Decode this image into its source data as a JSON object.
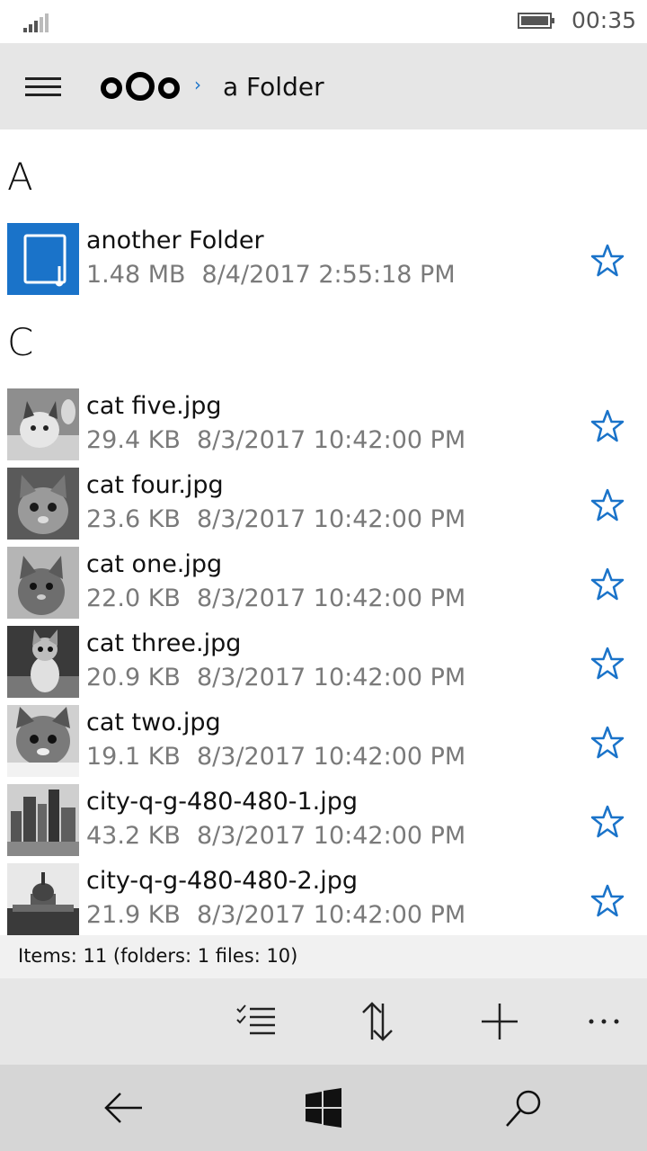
{
  "status": {
    "time": "00:35"
  },
  "header": {
    "breadcrumb_separator": "›",
    "folder_title": "a Folder"
  },
  "list": {
    "groups": [
      {
        "letter": "A"
      },
      {
        "letter": "C"
      }
    ],
    "items": [
      {
        "name": "another Folder",
        "size": "1.48 MB",
        "date": "8/4/2017 2:55:18 PM",
        "type": "folder"
      },
      {
        "name": "cat five.jpg",
        "size": "29.4 KB",
        "date": "8/3/2017 10:42:00 PM",
        "type": "image"
      },
      {
        "name": "cat four.jpg",
        "size": "23.6 KB",
        "date": "8/3/2017 10:42:00 PM",
        "type": "image"
      },
      {
        "name": "cat one.jpg",
        "size": "22.0 KB",
        "date": "8/3/2017 10:42:00 PM",
        "type": "image"
      },
      {
        "name": "cat three.jpg",
        "size": "20.9 KB",
        "date": "8/3/2017 10:42:00 PM",
        "type": "image"
      },
      {
        "name": "cat two.jpg",
        "size": "19.1 KB",
        "date": "8/3/2017 10:42:00 PM",
        "type": "image"
      },
      {
        "name": "city-q-g-480-480-1.jpg",
        "size": "43.2 KB",
        "date": "8/3/2017 10:42:00 PM",
        "type": "image"
      },
      {
        "name": "city-q-g-480-480-2.jpg",
        "size": "21.9 KB",
        "date": "8/3/2017 10:42:00 PM",
        "type": "image"
      }
    ]
  },
  "footer": {
    "items_summary": "Items: 11 (folders: 1 files: 10)"
  },
  "colors": {
    "accent": "#1a73c9",
    "header_bg": "#e6e6e6",
    "meta_text": "#7a7a7a"
  },
  "icons": [
    "signal-icon",
    "battery-icon",
    "hamburger-menu-icon",
    "nextcloud-logo",
    "folder-icon",
    "star-icon",
    "select-list-icon",
    "sort-icon",
    "add-icon",
    "more-icon",
    "back-arrow-icon",
    "windows-icon",
    "search-icon"
  ]
}
